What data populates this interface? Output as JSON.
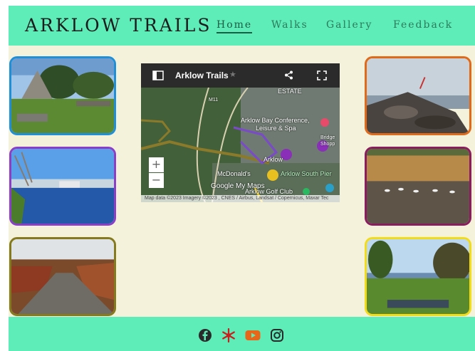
{
  "header": {
    "site_title": "ARKLOW TRAILS",
    "nav": [
      {
        "label": "Home",
        "active": true
      },
      {
        "label": "Walks",
        "active": false
      },
      {
        "label": "Gallery",
        "active": false
      },
      {
        "label": "Feedback",
        "active": false
      }
    ]
  },
  "map": {
    "title": "Arklow Trails",
    "labels": {
      "estate": "ESTATE",
      "conference": "Arklow Bay Conference,",
      "leisure": "Leisure & Spa",
      "arklow": "Arklow",
      "mcdonalds": "McDonald's",
      "south_pier": "Arklow South Pier",
      "golf": "Arklow Golf Club",
      "road": "M11",
      "bridge": "Bridge",
      "shopping": "Shopp"
    },
    "zoom_in": "+",
    "zoom_out": "−",
    "credits": "Map data ©2023 Imagery ©2023 , CNES / Airbus, Landsat / Copernicus, Maxar Tec",
    "watermark": "Google My Maps"
  },
  "thumbnails": [
    {
      "name": "pyramid-tomb-photo",
      "border_color": "#1e8fd8"
    },
    {
      "name": "river-photo",
      "border_color": "#8a3fc8"
    },
    {
      "name": "trail-path-photo",
      "border_color": "#857a1e"
    },
    {
      "name": "rocky-pier-photo",
      "border_color": "#e0691a"
    },
    {
      "name": "reeds-swans-photo",
      "border_color": "#8a1d5e"
    },
    {
      "name": "sea-view-lawn-photo",
      "border_color": "#f2dc1a"
    }
  ],
  "footer": {
    "social_icons": [
      "facebook-icon",
      "snowflake-icon",
      "youtube-icon",
      "instagram-icon"
    ]
  },
  "colors": {
    "header_bg": "#5eedb8",
    "page_bg": "#f5f2dc",
    "nav_text": "#2c7a5c"
  }
}
